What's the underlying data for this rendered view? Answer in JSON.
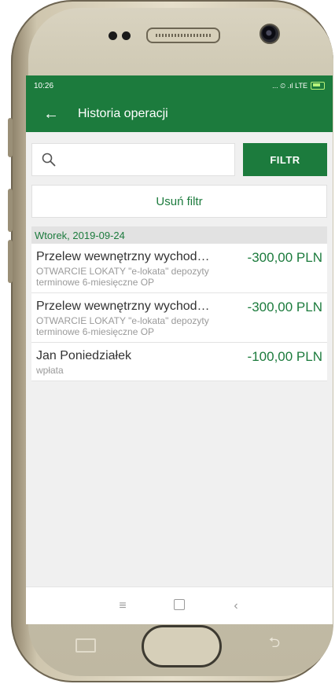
{
  "status_bar": {
    "time": "10:26",
    "indicators": "... ⏲ .ıl LTE"
  },
  "app_bar": {
    "back_icon": "arrow-left-icon",
    "title": "Historia operacji"
  },
  "search": {
    "placeholder": "",
    "value": "",
    "icon": "search-icon"
  },
  "filter_button": {
    "label": "FILTR"
  },
  "clear_filter": {
    "label": "Usuń filtr"
  },
  "date_group": {
    "label": "Wtorek, 2019-09-24"
  },
  "transactions": [
    {
      "name": "Przelew wewnętrzny wychod…",
      "description": "OTWARCIE LOKATY \"e-lokata\" depozyty terminowe 6-miesięczne OP",
      "amount": "-300,00 PLN"
    },
    {
      "name": "Przelew wewnętrzny wychod…",
      "description": "OTWARCIE LOKATY \"e-lokata\" depozyty terminowe 6-miesięczne OP",
      "amount": "-300,00 PLN"
    },
    {
      "name": "Jan Poniedziałek",
      "description": "wpłata",
      "amount": "-100,00 PLN"
    }
  ],
  "nav_bar": {
    "recent": "≡",
    "home": "",
    "back": "‹"
  },
  "colors": {
    "brand_green": "#1c7b3d",
    "background": "#f0f0f0",
    "muted_text": "#9a9a9a"
  }
}
